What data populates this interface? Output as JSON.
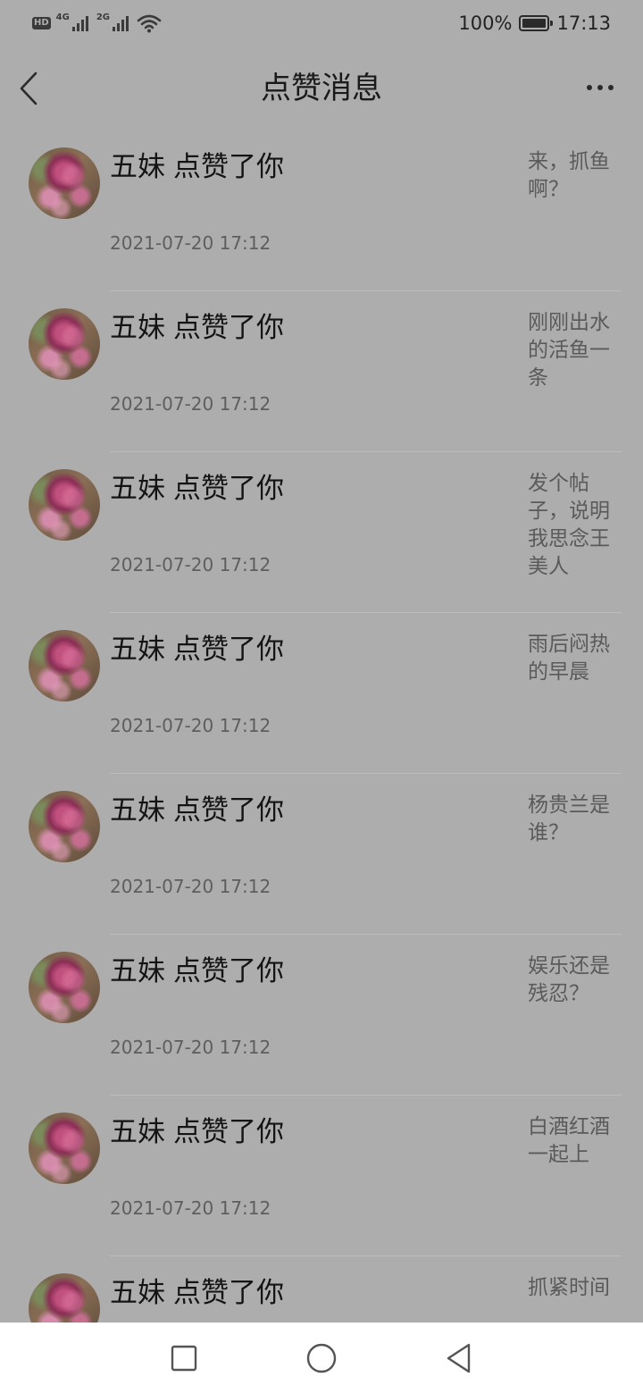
{
  "status_bar": {
    "hd_label": "HD",
    "net1_label": "4G",
    "net2_label": "2G",
    "battery_text": "100%",
    "time": "17:13"
  },
  "header": {
    "title": "点赞消息"
  },
  "notifications": [
    {
      "user": "五妹",
      "action": "点赞了你",
      "time": "2021-07-20 17:12",
      "snippet": "来，抓鱼啊？"
    },
    {
      "user": "五妹",
      "action": "点赞了你",
      "time": "2021-07-20 17:12",
      "snippet": "刚刚出水的活鱼一条"
    },
    {
      "user": "五妹",
      "action": "点赞了你",
      "time": "2021-07-20 17:12",
      "snippet": "发个帖子，说明我思念王美人"
    },
    {
      "user": "五妹",
      "action": "点赞了你",
      "time": "2021-07-20 17:12",
      "snippet": "雨后闷热的早晨"
    },
    {
      "user": "五妹",
      "action": "点赞了你",
      "time": "2021-07-20 17:12",
      "snippet": "杨贵兰是谁？"
    },
    {
      "user": "五妹",
      "action": "点赞了你",
      "time": "2021-07-20 17:12",
      "snippet": "娱乐还是残忍？"
    },
    {
      "user": "五妹",
      "action": "点赞了你",
      "time": "2021-07-20 17:12",
      "snippet": "白酒红酒一起上"
    },
    {
      "user": "五妹",
      "action": "点赞了你",
      "time": "",
      "snippet": "抓紧时间"
    }
  ]
}
